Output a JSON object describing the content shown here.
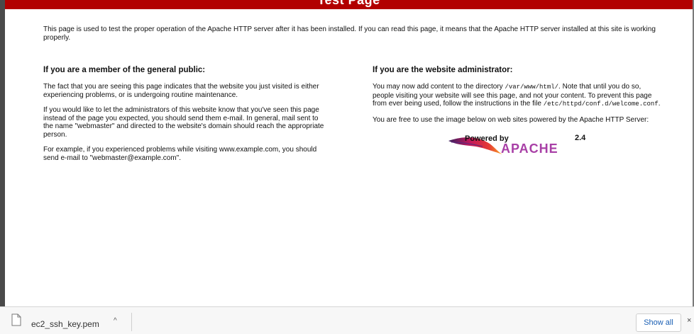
{
  "page": {
    "banner_title": "Test Page",
    "intro": "This page is used to test the proper operation of the Apache HTTP server after it has been installed. If you can read this page, it means that the Apache HTTP server installed at this site is working properly."
  },
  "public": {
    "heading": "If you are a member of the general public:",
    "p1": "The fact that you are seeing this page indicates that the website you just visited is either experiencing problems, or is undergoing routine maintenance.",
    "p2": "If you would like to let the administrators of this website know that you've seen this page instead of the page you expected, you should send them e-mail. In general, mail sent to the name \"webmaster\" and directed to the website's domain should reach the appropriate person.",
    "p3": "For example, if you experienced problems while visiting www.example.com, you should send e-mail to \"webmaster@example.com\"."
  },
  "admin": {
    "heading": "If you are the website administrator:",
    "p1_a": "You may now add content to the directory ",
    "p1_code1": "/var/www/html/",
    "p1_b": ". Note that until you do so, people visiting your website will see this page, and not your content. To prevent this page from ever being used, follow the instructions in the file ",
    "p1_code2": "/etc/httpd/conf.d/welcome.conf",
    "p1_c": ".",
    "p2": "You are free to use the image below on web sites powered by the Apache HTTP Server:"
  },
  "badge": {
    "powered": "Powered by",
    "version": "2.4",
    "name": "APACHE"
  },
  "downloads": {
    "file_name": "ec2_ssh_key.pem",
    "chevron": "^",
    "show_all": "Show all",
    "close": "×",
    "file_icon": "document-icon"
  },
  "colors": {
    "banner": "#b20000",
    "link": "#1a5fb4"
  }
}
